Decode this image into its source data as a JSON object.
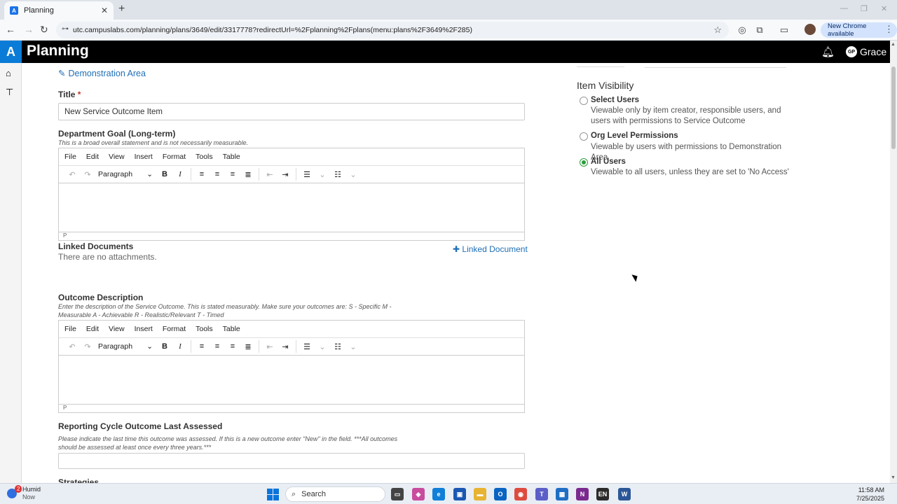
{
  "browser": {
    "tab_title": "Planning",
    "tab_favicon_letter": "A",
    "url": "utc.campuslabs.com/planning/plans/3649/edit/3317778?redirectUrl=%2Fplanning%2Fplans(menu:plans%2F3649%2F285)",
    "new_chrome_label": "New Chrome available"
  },
  "app": {
    "logo_letter": "A",
    "title": "Planning",
    "user_initials": "GP",
    "user_name": "Grace"
  },
  "form": {
    "demo_area_link": "Demonstration Area",
    "title_label": "Title",
    "title_required": "*",
    "title_value": "New Service Outcome Item",
    "dept_goal_label": "Department Goal (Long-term)",
    "dept_goal_help": "This is a broad overall statement and is not necessarily measurable.",
    "linked_docs_label": "Linked Documents",
    "linked_doc_button": "Linked Document",
    "no_attachments": "There are no attachments.",
    "outcome_label": "Outcome Description",
    "outcome_help": "Enter the description of the Service Outcome. This is stated measurably. Make sure your outcomes are: S - Specific M - Measurable A - Achievable R - Realistic/Relevant T - Timed",
    "cycle_label": "Reporting Cycle Outcome Last Assessed",
    "cycle_help": "Please indicate the last time this outcome was assessed. If this is a new outcome enter \"New\" in the field. ***All outcomes should be assessed at least once every three years.***",
    "strategies_label": "Strategies"
  },
  "editor": {
    "menus": [
      "File",
      "Edit",
      "View",
      "Insert",
      "Format",
      "Tools",
      "Table"
    ],
    "block_format": "Paragraph",
    "status_path": "P",
    "bold": "B",
    "italic": "I"
  },
  "visibility": {
    "heading": "Item Visibility",
    "options": [
      {
        "label": "Select Users",
        "desc": "Viewable only by item creator, responsible users, and users with permissions to Service Outcome",
        "selected": false
      },
      {
        "label": "Org Level Permissions",
        "desc": "Viewable by users with permissions to Demonstration Area",
        "selected": false
      },
      {
        "label": "All Users",
        "desc": "Viewable to all users, unless they are set to 'No Access'",
        "selected": true
      }
    ]
  },
  "taskbar": {
    "weather_badge": "2",
    "weather_title": "Humid",
    "weather_sub": "Now",
    "search_label": "Search",
    "time": "11:58 AM",
    "date": "7/25/2025"
  },
  "colors": {
    "link": "#1f6fb5",
    "selected_radio": "#2e9e3a",
    "appbar": "#000000",
    "logo": "#0a7bd6"
  }
}
